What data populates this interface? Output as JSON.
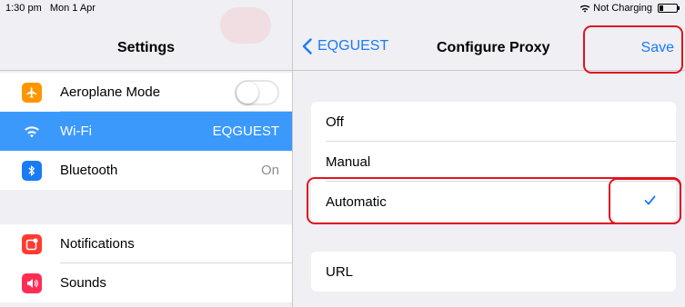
{
  "status": {
    "time": "1:30 pm",
    "date": "Mon 1 Apr",
    "charging": "Not Charging"
  },
  "sidebar": {
    "title": "Settings",
    "items": [
      {
        "label": "Aeroplane Mode",
        "icon": "airplane-icon",
        "color": "#ff9500",
        "value": "",
        "toggle": false
      },
      {
        "label": "Wi-Fi",
        "icon": "wifi-icon",
        "color": "#3b99fc",
        "value": "EQGUEST",
        "selected": true
      },
      {
        "label": "Bluetooth",
        "icon": "bluetooth-icon",
        "color": "#1a7cf5",
        "value": "On"
      },
      {
        "label": "Notifications",
        "icon": "notifications-icon",
        "color": "#ff3b30",
        "value": ""
      },
      {
        "label": "Sounds",
        "icon": "sounds-icon",
        "color": "#ff2d55",
        "value": ""
      }
    ]
  },
  "detail": {
    "back_label": "EQGUEST",
    "title": "Configure Proxy",
    "save_label": "Save",
    "options": [
      {
        "label": "Off",
        "checked": false
      },
      {
        "label": "Manual",
        "checked": false
      },
      {
        "label": "Automatic",
        "checked": true
      }
    ],
    "url_label": "URL"
  },
  "colors": {
    "accent": "#1a7cf5",
    "selection": "#3b99fc",
    "highlight": "#e0141e"
  }
}
